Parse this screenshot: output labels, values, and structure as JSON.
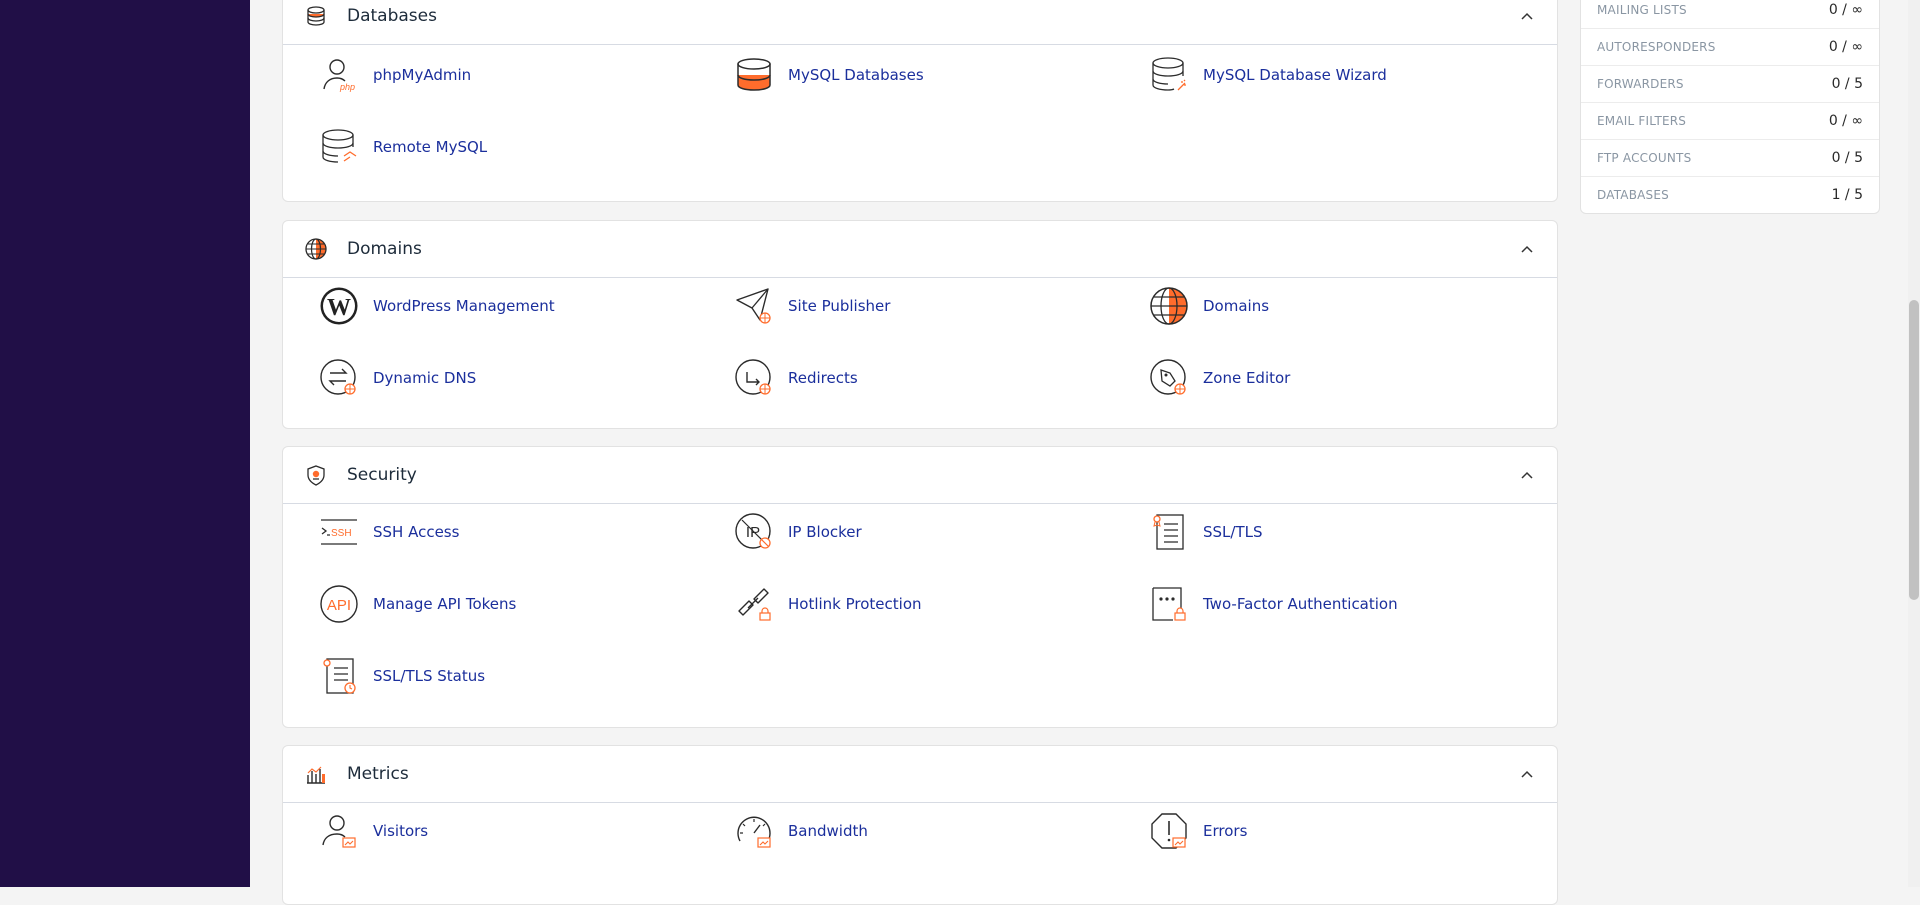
{
  "stats": [
    {
      "label": "MAILING LISTS",
      "value": "0 / ∞"
    },
    {
      "label": "AUTORESPONDERS",
      "value": "0 / ∞"
    },
    {
      "label": "FORWARDERS",
      "value": "0 / 5"
    },
    {
      "label": "EMAIL FILTERS",
      "value": "0 / ∞"
    },
    {
      "label": "FTP ACCOUNTS",
      "value": "0 / 5"
    },
    {
      "label": "DATABASES",
      "value": "1 / 5"
    }
  ],
  "sections": {
    "databases": {
      "title": "Databases",
      "icon": "database-icon",
      "items": [
        {
          "label": "phpMyAdmin",
          "icon": "phpmyadmin-icon"
        },
        {
          "label": "MySQL Databases",
          "icon": "mysql-databases-icon"
        },
        {
          "label": "MySQL Database Wizard",
          "icon": "database-wizard-icon"
        },
        {
          "label": "Remote MySQL",
          "icon": "remote-mysql-icon"
        }
      ]
    },
    "domains": {
      "title": "Domains",
      "icon": "globe-icon",
      "items": [
        {
          "label": "WordPress Management",
          "icon": "wordpress-icon"
        },
        {
          "label": "Site Publisher",
          "icon": "paper-plane-icon"
        },
        {
          "label": "Domains",
          "icon": "globe-icon"
        },
        {
          "label": "Dynamic DNS",
          "icon": "dynamic-dns-icon"
        },
        {
          "label": "Redirects",
          "icon": "redirect-icon"
        },
        {
          "label": "Zone Editor",
          "icon": "zone-editor-icon"
        }
      ]
    },
    "security": {
      "title": "Security",
      "icon": "shield-icon",
      "items": [
        {
          "label": "SSH Access",
          "icon": "ssh-terminal-icon"
        },
        {
          "label": "IP Blocker",
          "icon": "ip-blocker-icon"
        },
        {
          "label": "SSL/TLS",
          "icon": "certificate-icon"
        },
        {
          "label": "Manage API Tokens",
          "icon": "api-icon"
        },
        {
          "label": "Hotlink Protection",
          "icon": "link-lock-icon"
        },
        {
          "label": "Two-Factor Authentication",
          "icon": "two-factor-icon"
        },
        {
          "label": "SSL/TLS Status",
          "icon": "certificate-status-icon"
        }
      ]
    },
    "metrics": {
      "title": "Metrics",
      "icon": "bar-chart-icon",
      "items": [
        {
          "label": "Visitors",
          "icon": "visitors-icon"
        },
        {
          "label": "Bandwidth",
          "icon": "speedometer-icon"
        },
        {
          "label": "Errors",
          "icon": "error-octagon-icon"
        }
      ]
    }
  },
  "colors": {
    "sidebar": "#210f47",
    "accent": "#ff6c2c",
    "link": "#1b2f9c",
    "icon_stroke": "#2b2b2b"
  }
}
